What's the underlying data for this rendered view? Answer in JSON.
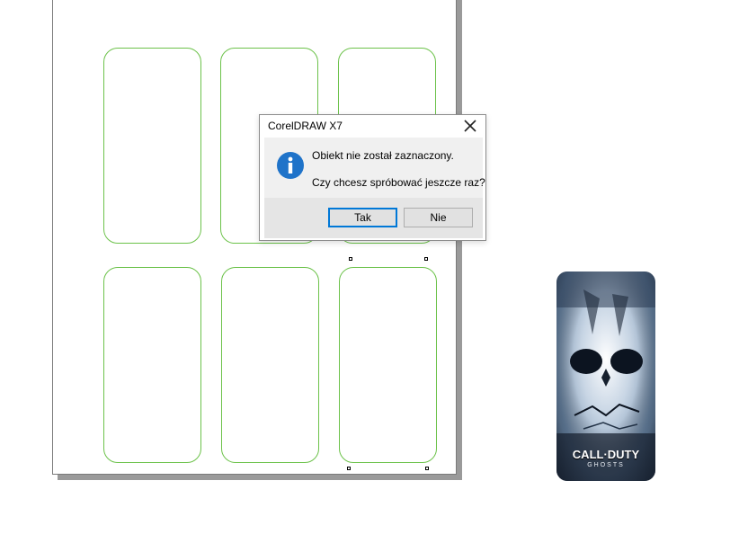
{
  "dialog": {
    "title": "CorelDRAW X7",
    "message_line1": "Obiekt nie został zaznaczony.",
    "message_line2": "Czy chcesz spróbować jeszcze raz?",
    "yes_label": "Tak",
    "no_label": "Nie",
    "icon": "info-icon"
  },
  "preview": {
    "brand_main": "CALL·DUTY",
    "brand_sub": "GHOSTS"
  },
  "colors": {
    "outline": "#6cc24a",
    "info_icon": "#1f73c9",
    "default_button_border": "#0078d7"
  }
}
